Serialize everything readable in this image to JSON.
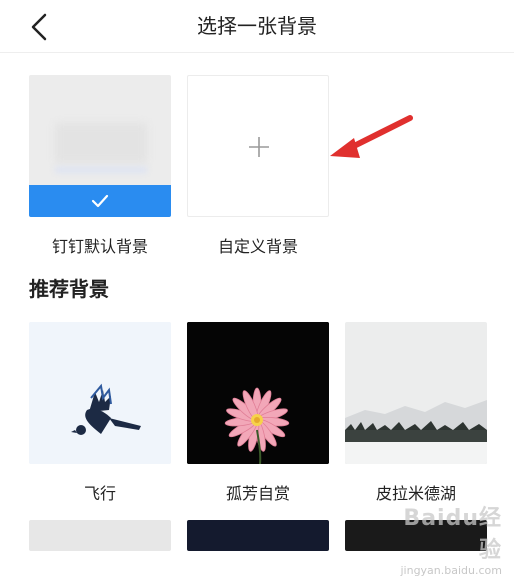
{
  "header": {
    "title": "选择一张背景",
    "back_icon": "chevron-left-icon"
  },
  "backgrounds_top": [
    {
      "label": "钉钉默认背景",
      "selected": true,
      "selected_icon": "check-icon"
    },
    {
      "label": "自定义背景",
      "icon": "plus-icon"
    }
  ],
  "recommended": {
    "title": "推荐背景",
    "items": [
      {
        "label": "飞行"
      },
      {
        "label": "孤芳自赏"
      },
      {
        "label": "皮拉米德湖"
      }
    ]
  },
  "colors": {
    "accent": "#2a8cf0",
    "arrow": "#e0302e"
  },
  "watermark": {
    "brand": "Baidu经验",
    "url": "jingyan.baidu.com"
  }
}
